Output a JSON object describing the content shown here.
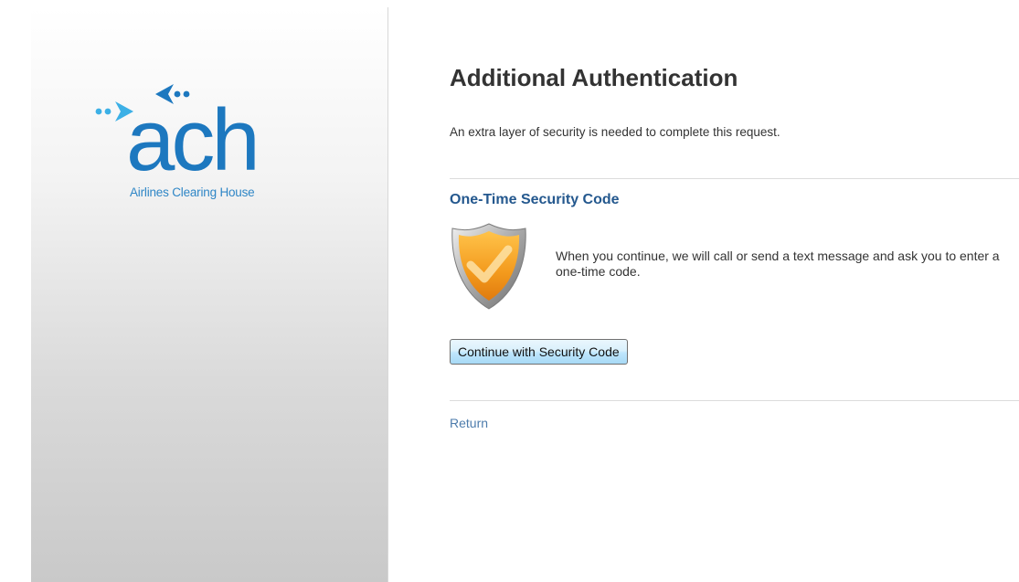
{
  "brand": {
    "logo_text": "ach",
    "tagline": "Airlines Clearing House",
    "color": "#1d78bf"
  },
  "page": {
    "title": "Additional Authentication",
    "intro": "An extra layer of security is needed to complete this request."
  },
  "security": {
    "heading": "One-Time Security Code",
    "icon": "shield-checkmark-icon",
    "description": "When you continue, we will call or send a text message and ask you to enter a one-time code.",
    "button_label": "Continue with Security Code"
  },
  "footer": {
    "return_label": "Return"
  },
  "colors": {
    "heading": "#24588e",
    "link": "#4d7cac",
    "shield_orange": "#f0a020"
  }
}
